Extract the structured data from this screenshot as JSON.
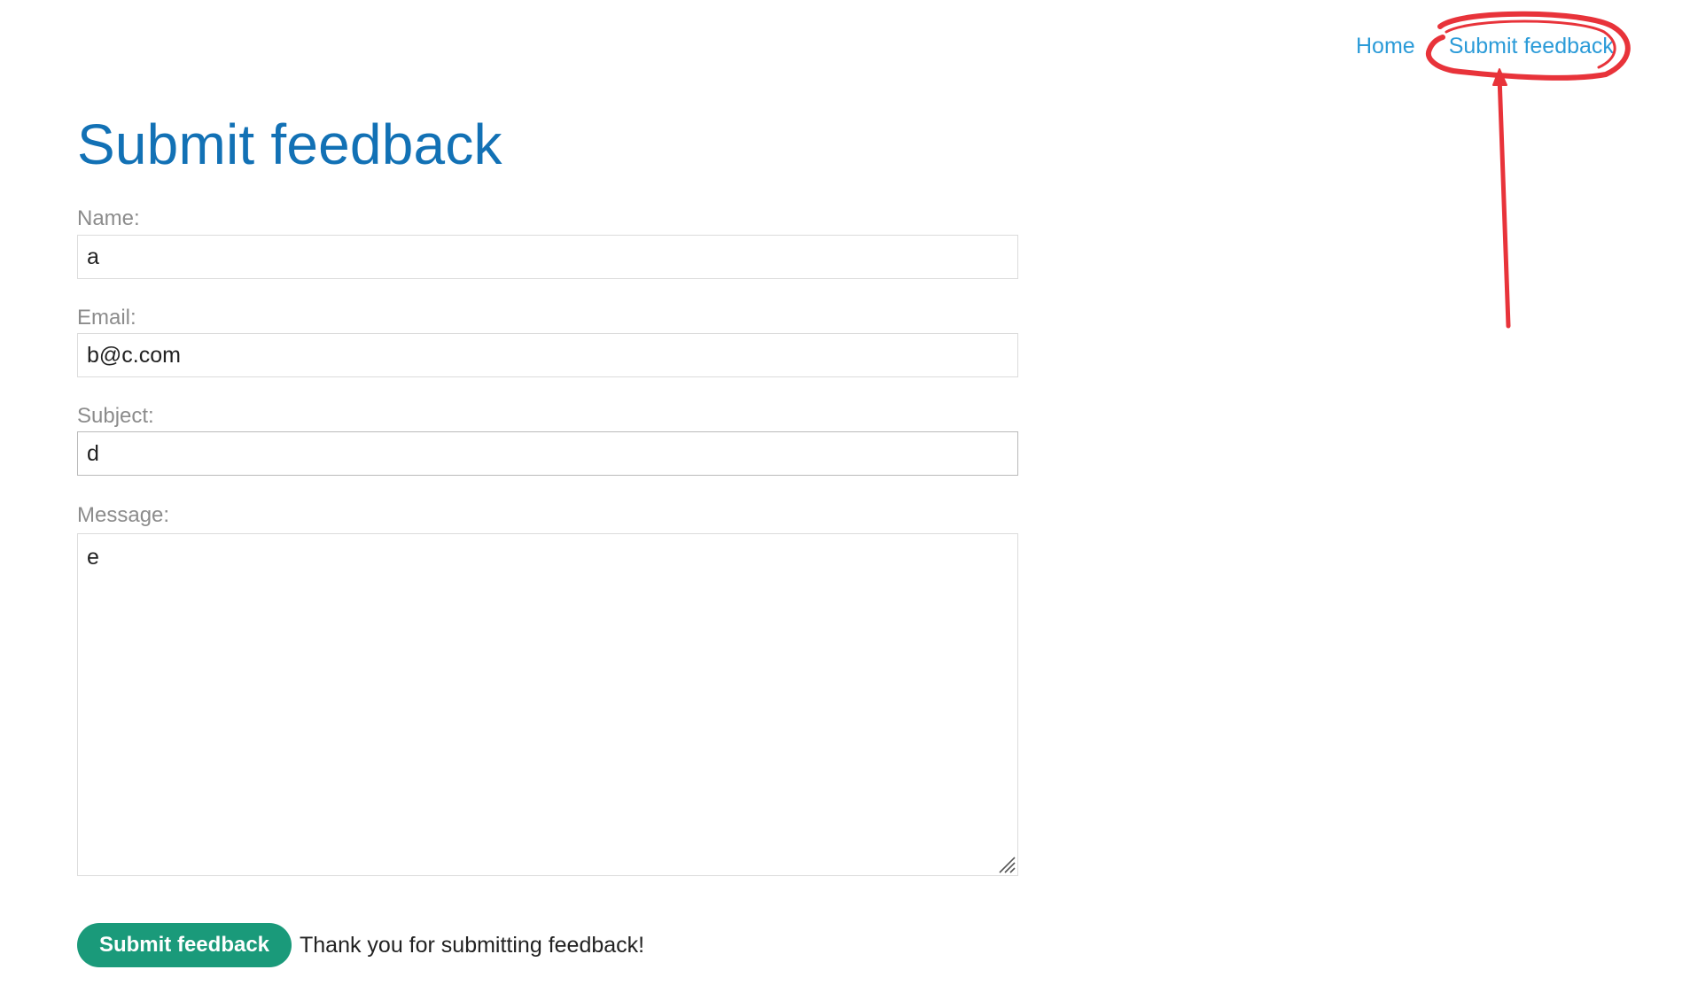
{
  "nav": {
    "home_label": "Home",
    "feedback_label": "Submit feedback"
  },
  "page_title": "Submit feedback",
  "form": {
    "name_label": "Name:",
    "name_value": "a",
    "email_label": "Email:",
    "email_value": "b@c.com",
    "subject_label": "Subject:",
    "subject_value": "d",
    "message_label": "Message:",
    "message_value": "e",
    "submit_label": "Submit feedback"
  },
  "status_message": "Thank you for submitting feedback!",
  "colors": {
    "link": "#2b9bd8",
    "title": "#1271b5",
    "button": "#1a9a7a",
    "annotation": "#e8333a"
  }
}
